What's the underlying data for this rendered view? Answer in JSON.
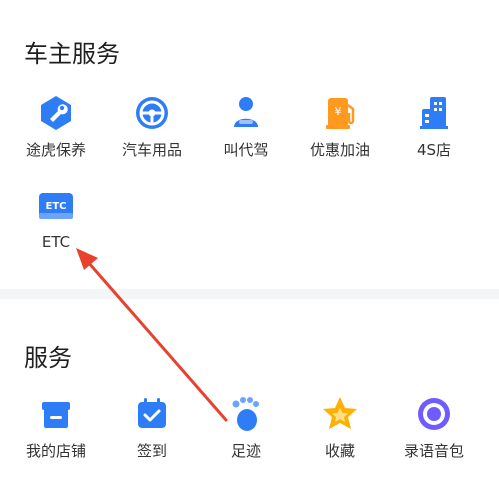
{
  "car_owner_services": {
    "title": "车主服务",
    "items": [
      {
        "label": "途虎保养",
        "icon": "wrench-hexagon-icon"
      },
      {
        "label": "汽车用品",
        "icon": "steering-wheel-icon"
      },
      {
        "label": "叫代驾",
        "icon": "driver-icon"
      },
      {
        "label": "优惠加油",
        "icon": "fuel-pump-icon"
      },
      {
        "label": "4S店",
        "icon": "building-icon"
      },
      {
        "label": "ETC",
        "icon": "etc-card-icon"
      }
    ]
  },
  "services": {
    "title": "服务",
    "items": [
      {
        "label": "我的店铺",
        "icon": "store-icon"
      },
      {
        "label": "签到",
        "icon": "calendar-check-icon"
      },
      {
        "label": "足迹",
        "icon": "footprint-icon"
      },
      {
        "label": "收藏",
        "icon": "star-icon"
      },
      {
        "label": "录语音包",
        "icon": "record-icon"
      }
    ]
  },
  "colors": {
    "blue": "#2f7df6",
    "orange": "#ff9a1f",
    "purple": "#6f5bff",
    "annotation_red": "#e8412e"
  }
}
